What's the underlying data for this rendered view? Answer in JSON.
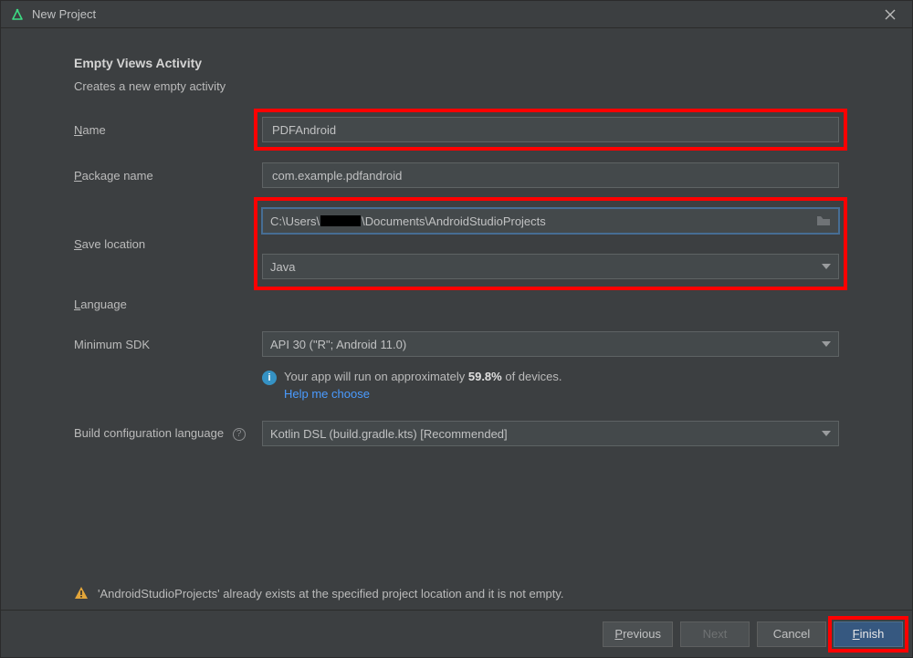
{
  "window": {
    "title": "New Project"
  },
  "section": {
    "title": "Empty Views Activity",
    "subtitle": "Creates a new empty activity"
  },
  "labels": {
    "name": "Name",
    "package": "Package name",
    "save": "Save location",
    "language": "Language",
    "minsdk": "Minimum SDK",
    "buildlang": "Build configuration language"
  },
  "fields": {
    "name": "PDFAndroid",
    "package": "com.example.pdfandroid",
    "save_prefix": "C:\\Users\\",
    "save_suffix": "\\Documents\\AndroidStudioProjects",
    "language": "Java",
    "minsdk": "API 30 (\"R\"; Android 11.0)",
    "buildlang": "Kotlin DSL (build.gradle.kts) [Recommended]"
  },
  "info": {
    "prefix": "Your app will run on approximately ",
    "percent": "59.8%",
    "suffix": " of devices.",
    "help": "Help me choose"
  },
  "warning": "'AndroidStudioProjects' already exists at the specified project location and it is not empty.",
  "buttons": {
    "previous": "Previous",
    "next": "Next",
    "cancel": "Cancel",
    "finish": "Finish"
  }
}
